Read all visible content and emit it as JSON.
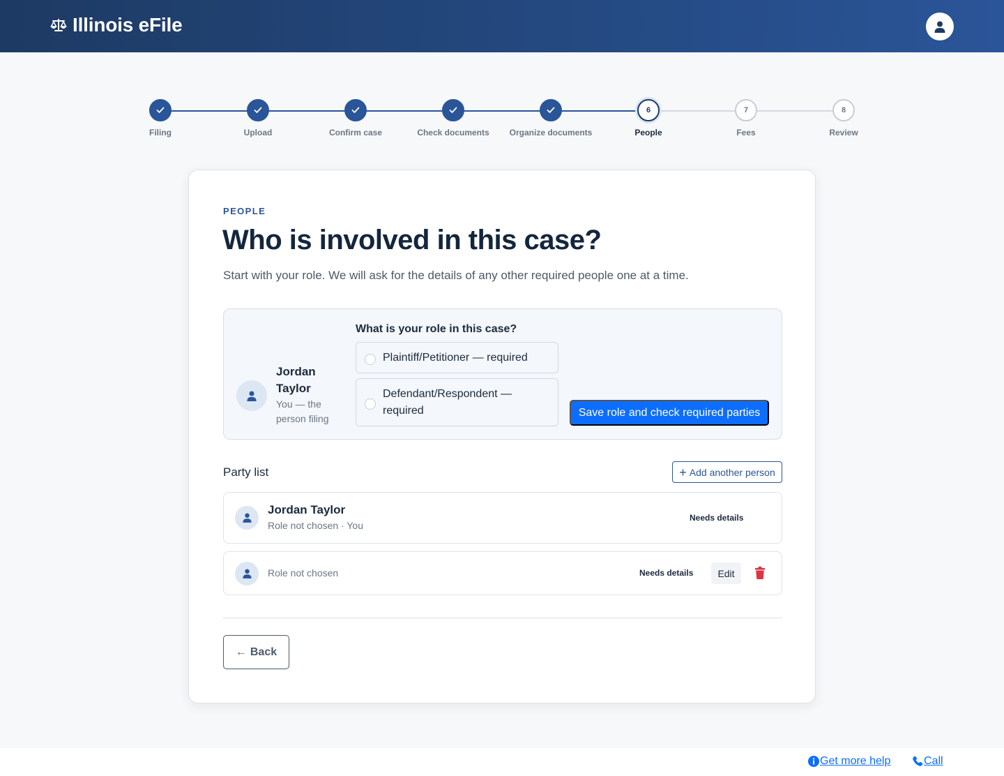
{
  "app": {
    "title": "Illinois eFile"
  },
  "stepper": {
    "steps": [
      {
        "label": "Filing",
        "state": "done",
        "number": "1"
      },
      {
        "label": "Upload",
        "state": "done",
        "number": "2"
      },
      {
        "label": "Confirm case",
        "state": "done",
        "number": "3"
      },
      {
        "label": "Check documents",
        "state": "done",
        "number": "4"
      },
      {
        "label": "Organize documents",
        "state": "done",
        "number": "5"
      },
      {
        "label": "People",
        "state": "current",
        "number": "6"
      },
      {
        "label": "Fees",
        "state": "todo",
        "number": "7"
      },
      {
        "label": "Review",
        "state": "todo",
        "number": "8"
      }
    ]
  },
  "page": {
    "eyebrow": "PEOPLE",
    "title": "Who is involved in this case?",
    "lead": "Start with your role. We will ask for the details of any other required people one at a time."
  },
  "role_panel": {
    "person_name": "Jordan Taylor",
    "person_sub": "You — the person filing",
    "question": "What is your role in this case?",
    "options": [
      "Plaintiff/Petitioner — required",
      "Defendant/Respondent — required"
    ],
    "save_label": "Save role and check required parties"
  },
  "party_list": {
    "heading": "Party list",
    "add_label": "Add another person",
    "rows": [
      {
        "name": "Jordan Taylor",
        "sub": "Role not chosen · You",
        "status": "Needs details"
      },
      {
        "name": "",
        "sub": "Role not chosen",
        "status": "Needs details",
        "edit_label": "Edit"
      }
    ]
  },
  "nav": {
    "back_label": "Back"
  },
  "footer": {
    "help_label": "Get more help",
    "call_label": "Call"
  },
  "colors": {
    "primary": "#2a5598",
    "button": "#0d6efd",
    "danger": "#dc3545"
  }
}
